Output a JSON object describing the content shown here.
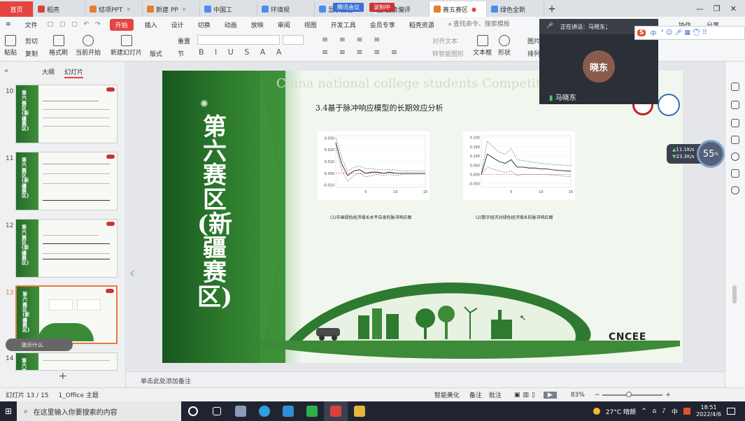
{
  "tabs": [
    {
      "label": "首页",
      "kind": "home"
    },
    {
      "label": "稻壳",
      "kind": "r"
    },
    {
      "label": "结项PPT",
      "kind": "o"
    },
    {
      "label": "新建 PP",
      "kind": "o"
    },
    {
      "label": "中国工",
      "kind": "b"
    },
    {
      "label": "环境规",
      "kind": "b"
    },
    {
      "label": "显示报告",
      "kind": "b"
    },
    {
      "label": "要素偏评",
      "kind": "b"
    },
    {
      "label": "赛五赛区",
      "kind": "o",
      "active": true
    },
    {
      "label": "绿色全新",
      "kind": "b"
    }
  ],
  "meeting": {
    "app": "腾讯会议",
    "rec": "录制中"
  },
  "menu": [
    "文件",
    "开始",
    "插入",
    "设计",
    "切换",
    "动画",
    "放映",
    "审阅",
    "视图",
    "开发工具",
    "会员专享",
    "稻壳资源"
  ],
  "menu_search": "查找命令、搜索模板",
  "menu_right": [
    "协作",
    "分享"
  ],
  "ribbon": {
    "paste": "粘贴",
    "cut": "剪切",
    "copy": "复制",
    "format_painter": "格式刷",
    "from_current": "当前开始",
    "new_slide": "新建幻灯片",
    "layout": "版式",
    "section": "节",
    "reset": "重置",
    "text_box": "文本框",
    "shape": "形状",
    "arrange": "排列",
    "picture": "图片",
    "align_text": "对齐文本",
    "convert_smartart": "转智能图形"
  },
  "left_panel": {
    "tabs": [
      "大纲",
      "幻灯片"
    ],
    "active_tab": "幻灯片",
    "slides": [
      {
        "no": "10",
        "title": "第六赛区(新疆赛区)"
      },
      {
        "no": "11",
        "title": "第六赛区(新疆赛区)"
      },
      {
        "no": "12",
        "title": "第六赛区(新疆赛区)"
      },
      {
        "no": "13",
        "title": "第六赛区(新疆赛区)",
        "selected": true
      },
      {
        "no": "14",
        "title": "第六赛区(新疆赛区)"
      }
    ],
    "tooltip": "演示什么",
    "add": "+"
  },
  "slide": {
    "vertical_title": "第六赛区(新疆赛区)",
    "watermark": "China national college students Competition",
    "title": "3.4基于脉冲响应模型的长期效应分析",
    "caption1": "(1)中国绿色经济增长水平自身的脉冲响应图",
    "caption2": "(2)数字经济对绿色经济增长的脉冲响应图",
    "brand": "CNCEE"
  },
  "chart_data": [
    {
      "type": "line",
      "title": "",
      "x": [
        0,
        1,
        2,
        3,
        4,
        5,
        6,
        7,
        8,
        9,
        10,
        11,
        12,
        13,
        14,
        15
      ],
      "xticks": [
        5,
        10,
        15
      ],
      "yticks": [
        -0.01,
        0.0,
        0.01,
        0.02,
        0.03
      ],
      "ylim": [
        -0.012,
        0.032
      ],
      "series": [
        {
          "values": [
            0.026,
            0.008,
            -0.002,
            0.002,
            0.003,
            0.0,
            0.001,
            0.001,
            0.0,
            0.001,
            0.0,
            0.0,
            0.0,
            0.0,
            0.0,
            0.0
          ],
          "style": "solid"
        },
        {
          "values": [
            0.03,
            0.013,
            0.002,
            0.005,
            0.006,
            0.004,
            0.004,
            0.003,
            0.003,
            0.003,
            0.003,
            0.002,
            0.002,
            0.002,
            0.002,
            0.002
          ],
          "style": "dashed"
        },
        {
          "values": [
            0.022,
            0.003,
            -0.007,
            -0.002,
            0.0,
            -0.003,
            -0.002,
            -0.001,
            -0.002,
            -0.001,
            -0.002,
            -0.001,
            -0.001,
            -0.001,
            -0.001,
            -0.001
          ],
          "style": "dashed"
        }
      ]
    },
    {
      "type": "line",
      "title": "",
      "x": [
        0,
        1,
        2,
        3,
        4,
        5,
        6,
        7,
        8,
        9,
        10,
        11,
        12,
        13,
        14,
        15
      ],
      "xticks": [
        5,
        10,
        15
      ],
      "yticks": [
        -0.05,
        0.0,
        0.05,
        0.1,
        0.15,
        0.2
      ],
      "ylim": [
        -0.07,
        0.21
      ],
      "series": [
        {
          "values": [
            0.0,
            0.11,
            0.09,
            0.07,
            0.06,
            0.08,
            0.04,
            0.04,
            0.035,
            0.035,
            0.03,
            0.03,
            0.025,
            0.022,
            0.02,
            0.018
          ],
          "style": "solid"
        },
        {
          "values": [
            0.0,
            0.18,
            0.15,
            0.12,
            0.11,
            0.14,
            0.08,
            0.075,
            0.07,
            0.065,
            0.06,
            0.058,
            0.055,
            0.052,
            0.05,
            0.048
          ],
          "style": "dashed"
        },
        {
          "values": [
            0.0,
            0.04,
            0.03,
            0.02,
            0.01,
            0.02,
            -0.005,
            0.0,
            0.0,
            0.0,
            0.0,
            0.0,
            -0.005,
            -0.005,
            -0.01,
            -0.01
          ],
          "style": "dashed"
        },
        {
          "values": [
            0,
            0,
            0,
            0,
            0,
            0,
            0,
            0,
            0,
            0,
            0,
            0,
            0,
            0,
            0,
            0
          ],
          "style": "red-dashed"
        }
      ]
    }
  ],
  "notes": "单击此处添加备注",
  "status": {
    "slide_info": "幻灯片 13 / 15",
    "theme": "1_Office 主题",
    "beautify": "智能美化",
    "notes": "备注",
    "comments": "批注",
    "zoom": "83%"
  },
  "video": {
    "status": "正在讲话：马晓东；",
    "avatar_text": "晓东",
    "name": "马晓东"
  },
  "net": {
    "up": "11.1K/s",
    "down": "23.3K/s",
    "cpu": "55"
  },
  "taskbar": {
    "search": "在这里输入你要搜索的内容",
    "weather": "27°C 晴朗",
    "ime": "中",
    "time": "18:51",
    "date": "2022/4/6"
  }
}
